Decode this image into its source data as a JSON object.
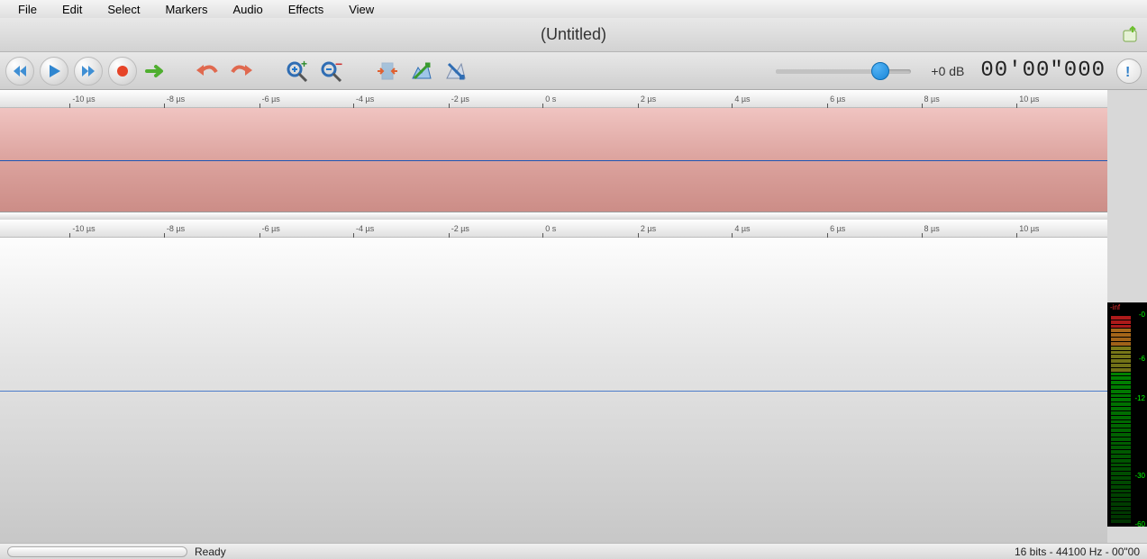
{
  "menu": {
    "items": [
      "File",
      "Edit",
      "Select",
      "Markers",
      "Audio",
      "Effects",
      "View"
    ]
  },
  "title": "(Untitled)",
  "toolbar": {
    "volume_label": "+0 dB",
    "timecode": "00'00\"000",
    "volume_pos_pct": 77
  },
  "ruler": {
    "ticks": [
      {
        "label": "-10 µs",
        "pct": 6.3
      },
      {
        "label": "-8 µs",
        "pct": 14.8
      },
      {
        "label": "-6 µs",
        "pct": 23.4
      },
      {
        "label": "-4 µs",
        "pct": 31.9
      },
      {
        "label": "-2 µs",
        "pct": 40.5
      },
      {
        "label": "0 s",
        "pct": 49.0
      },
      {
        "label": "2 µs",
        "pct": 57.6
      },
      {
        "label": "4 µs",
        "pct": 66.1
      },
      {
        "label": "6 µs",
        "pct": 74.7
      },
      {
        "label": "8 µs",
        "pct": 83.2
      },
      {
        "label": "10 µs",
        "pct": 91.8
      }
    ]
  },
  "vu": {
    "top_label": "-inf",
    "marks": [
      {
        "label": "-0",
        "pct": 3
      },
      {
        "label": "-6",
        "pct": 23
      },
      {
        "label": "-12",
        "pct": 41
      },
      {
        "label": "-30",
        "pct": 76
      },
      {
        "label": "-60",
        "pct": 98
      }
    ]
  },
  "status": {
    "ready": "Ready",
    "info": "16 bits - 44100 Hz - 00\"00"
  }
}
